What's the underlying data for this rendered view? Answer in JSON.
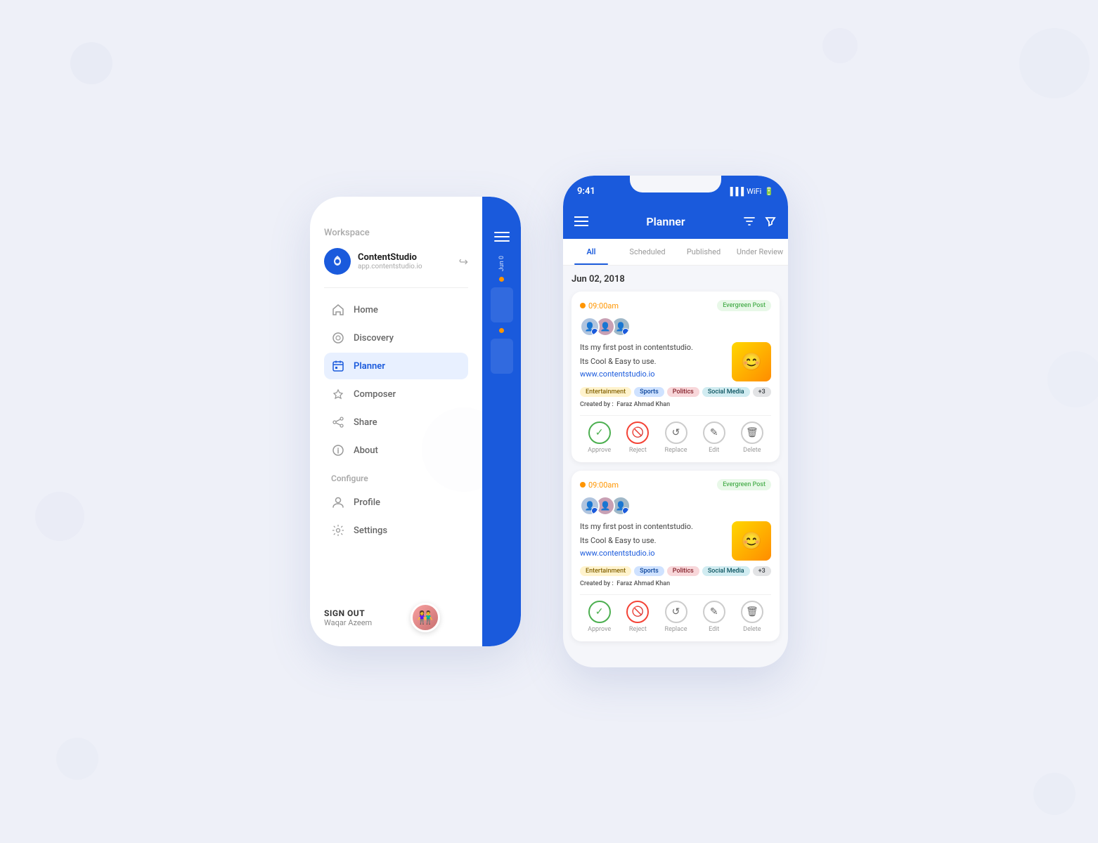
{
  "background": "#eef0f8",
  "leftPhone": {
    "workspace_label": "Workspace",
    "brand": {
      "name": "ContentStudio",
      "url": "app.contentstudio.io"
    },
    "nav": [
      {
        "id": "home",
        "label": "Home",
        "active": false
      },
      {
        "id": "discovery",
        "label": "Discovery",
        "active": false
      },
      {
        "id": "planner",
        "label": "Planner",
        "active": true
      },
      {
        "id": "composer",
        "label": "Composer",
        "active": false
      },
      {
        "id": "share",
        "label": "Share",
        "active": false
      },
      {
        "id": "about",
        "label": "About",
        "active": false
      }
    ],
    "configure_label": "Configure",
    "configure_nav": [
      {
        "id": "profile",
        "label": "Profile",
        "active": false
      },
      {
        "id": "settings",
        "label": "Settings",
        "active": false
      }
    ],
    "sign_out_label": "SIGN OUT",
    "user_name": "Waqar Azeem"
  },
  "rightPhone": {
    "status_time": "9:41",
    "header_title": "Planner",
    "tabs": [
      {
        "id": "all",
        "label": "All",
        "active": true
      },
      {
        "id": "scheduled",
        "label": "Scheduled",
        "active": false
      },
      {
        "id": "published",
        "label": "Published",
        "active": false
      },
      {
        "id": "under_review",
        "label": "Under Review",
        "active": false
      }
    ],
    "date_label": "Jun 02, 2018",
    "posts": [
      {
        "time": "09:00am",
        "badge": "Evergreen Post",
        "text_line1": "Its my first post in contentstudio.",
        "text_line2": "Its Cool & Easy to use.",
        "link": "www.contentstudio.io",
        "tags": [
          "Entertainment",
          "Sports",
          "Politics",
          "Social Media",
          "+3"
        ],
        "creator_label": "Created by :",
        "creator_name": "Faraz Ahmad Khan",
        "actions": [
          "Approve",
          "Reject",
          "Replace",
          "Edit",
          "Delete"
        ]
      },
      {
        "time": "09:00am",
        "badge": "Evergreen Post",
        "text_line1": "Its my first post in contentstudio.",
        "text_line2": "Its Cool & Easy to use.",
        "link": "www.contentstudio.io",
        "tags": [
          "Entertainment",
          "Sports",
          "Politics",
          "Social Media",
          "+3"
        ],
        "creator_label": "Created by :",
        "creator_name": "Faraz Ahmad Khan",
        "actions": [
          "Approve",
          "Reject",
          "Replace",
          "Edit",
          "Delete"
        ]
      }
    ]
  }
}
